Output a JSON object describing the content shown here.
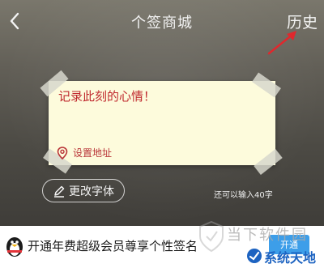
{
  "header": {
    "title": "个签商城",
    "history_label": "历史"
  },
  "note": {
    "placeholder": "记录此刻的心情！",
    "location_label": "设置地址"
  },
  "controls": {
    "font_button_label": "更改字体",
    "char_limit_text": "还可以输入40字"
  },
  "banner": {
    "text": "开通年费超级会员尊享个性签名",
    "button_label": "开通"
  },
  "watermark": {
    "text": "当下软件园",
    "site_name": "系统天地"
  },
  "colors": {
    "note_bg": "#fdfbdc",
    "note_text": "#c0292e",
    "accent_blue": "#3d9ee9",
    "arrow_red": "#e0282d"
  },
  "icons": [
    "back-arrow-icon",
    "map-pin-icon",
    "pen-icon",
    "penguin-icon",
    "red-annotation-arrow"
  ]
}
